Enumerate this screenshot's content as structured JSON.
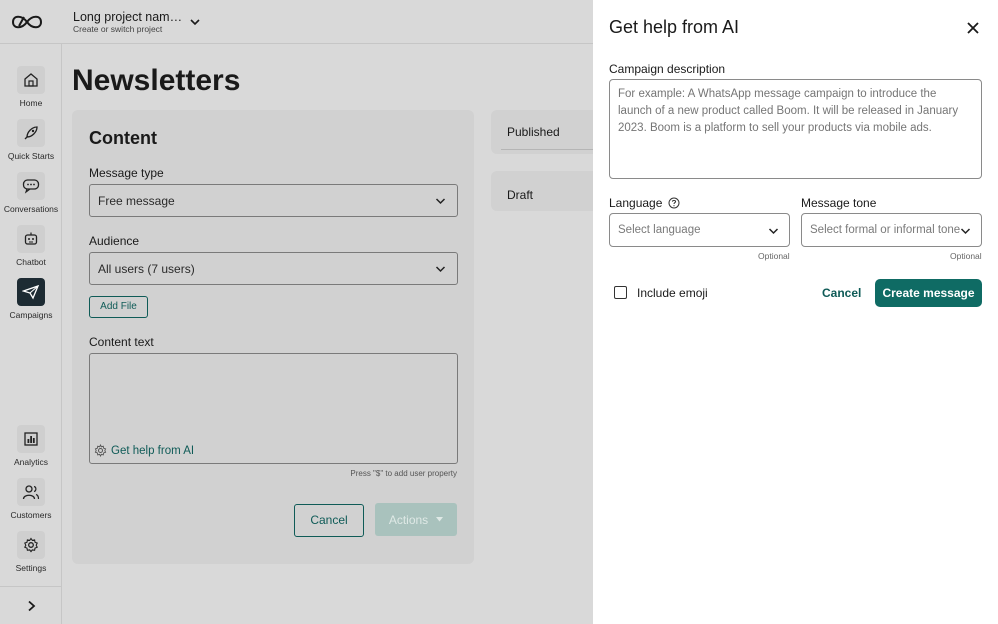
{
  "header": {
    "project_name": "Long project  nam…",
    "project_sub": "Create or switch project"
  },
  "sidebar": {
    "items": [
      {
        "label": "Home",
        "icon": "home-icon"
      },
      {
        "label": "Quick Starts",
        "icon": "rocket-icon"
      },
      {
        "label": "Conversations",
        "icon": "chat-icon"
      },
      {
        "label": "Chatbot",
        "icon": "robot-icon"
      },
      {
        "label": "Campaigns",
        "icon": "paper-plane-icon"
      },
      {
        "label": "Analytics",
        "icon": "bar-chart-icon"
      },
      {
        "label": "Customers",
        "icon": "users-icon"
      },
      {
        "label": "Settings",
        "icon": "gear-icon"
      }
    ],
    "active": "Campaigns"
  },
  "main": {
    "page_title": "Newsletters",
    "content": {
      "title": "Content",
      "message_type_label": "Message type",
      "message_type_value": "Free message",
      "audience_label": "Audience",
      "audience_value": "All users (7 users)",
      "add_file_label": "Add File",
      "content_text_label": "Content text",
      "ai_link_label": "Get help from AI",
      "hint": "Press \"$\" to add user property",
      "cancel_label": "Cancel",
      "actions_label": "Actions"
    },
    "side_cards": [
      {
        "label": "Published"
      },
      {
        "label": "Draft"
      }
    ]
  },
  "drawer": {
    "title": "Get help from AI",
    "campaign_label": "Campaign description",
    "campaign_placeholder": "For example: A WhatsApp message campaign to introduce the launch of a new product called Boom. It will be released in January 2023. Boom is a platform to sell your products via mobile ads.",
    "language_label": "Language",
    "language_placeholder": "Select language",
    "tone_label": "Message tone",
    "tone_placeholder": "Select formal or informal tone",
    "optional": "Optional",
    "emoji_label": "Include emoji",
    "cancel_label": "Cancel",
    "create_label": "Create message"
  },
  "colors": {
    "accent": "#0f6b64",
    "active_nav": "#1d2b33",
    "overlay": "#d9d9d9"
  }
}
